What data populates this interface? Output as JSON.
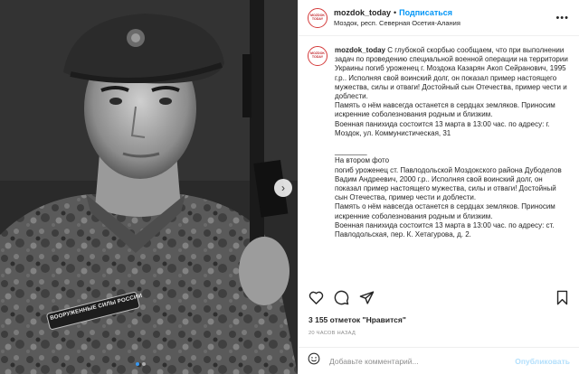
{
  "post": {
    "username": "mozdok_today",
    "follow_label": "Подписаться",
    "separator": "•",
    "location": "Моздок, респ. Северная Осетия-Алания",
    "avatar_text": "MOZDOK TODAY",
    "caption": "С глубокой скорбью сообщаем, что при выполнении задач по проведению специальной военной операции на территории Украины погиб уроженец г. Моздока Казарян Акоп Сейранович, 1995 г.р.. Исполняя свой воинский долг, он показал пример настоящего мужества, силы и отваги! Достойный сын Отечества, пример чести и доблести.\nПамять о нём навсегда останется в сердцах земляков. Приносим искренние соболезнования родным и близким.\nВоенная панихида состоится 13 марта в 13:00 час. по адресу: г. Моздок, ул. Коммунистическая, 31\n\n________\nНа втором фото\nпогиб уроженец ст. Павлодольской Моздокского района Дубоделов Вадим Андреевич, 2000 г.р.. Исполняя свой воинский долг, он показал пример настоящего мужества, силы и отваги! Достойный сын Отечества, пример чести и доблести.\nПамять о нём навсегда останется в сердцах земляков. Приносим искренние соболезнования родным и близким.\nВоенная панихида состоится 13 марта в 13:00 час. по адресу: ст. Павлодольская, пер. К. Хетагурова, д. 2.",
    "likes": "3 155 отметок \"Нравится\"",
    "time": "20 ЧАСОВ НАЗАД",
    "comment_placeholder": "Добавьте комментарий...",
    "publish_label": "Опубликовать",
    "patch_text": "ВООРУЖЕННЫЕ СИЛЫ РОССИИ",
    "carousel": {
      "count": 2,
      "active": 0
    }
  },
  "icons": [
    "more-icon",
    "heart-icon",
    "comment-icon",
    "share-icon",
    "bookmark-icon",
    "emoji-icon",
    "chevron-right-icon"
  ],
  "colors": {
    "accent": "#0095f6",
    "publish_disabled": "#b2dffc",
    "avatar_border": "#d43a3a"
  }
}
